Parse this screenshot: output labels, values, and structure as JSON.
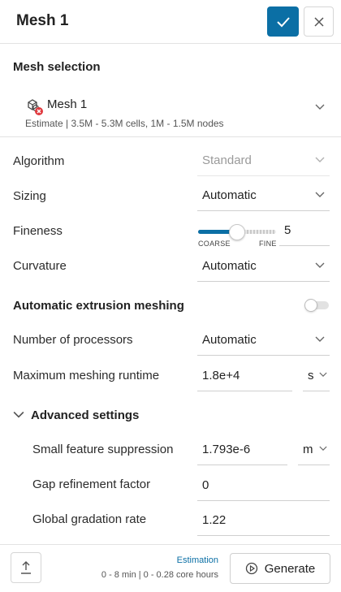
{
  "header": {
    "title": "Mesh 1",
    "confirm_icon": "check-icon",
    "close_icon": "close-icon"
  },
  "mesh_selection": {
    "title": "Mesh selection",
    "mesh_name": "Mesh 1",
    "estimate": "Estimate | 3.5M - 5.3M cells, 1M - 1.5M nodes",
    "icon": "mesh-error-icon"
  },
  "settings": {
    "algorithm": {
      "label": "Algorithm",
      "value": "Standard",
      "disabled": true
    },
    "sizing": {
      "label": "Sizing",
      "value": "Automatic"
    },
    "fineness": {
      "label": "Fineness",
      "value": "5",
      "level_fraction": 0.5,
      "min_label": "COARSE",
      "max_label": "FINE"
    },
    "curvature": {
      "label": "Curvature",
      "value": "Automatic"
    },
    "extrusion": {
      "label": "Automatic extrusion meshing",
      "enabled": false
    },
    "processors": {
      "label": "Number of processors",
      "value": "Automatic"
    },
    "runtime": {
      "label": "Maximum meshing runtime",
      "value": "1.8e+4",
      "unit": "s"
    }
  },
  "advanced": {
    "title": "Advanced settings",
    "expanded": true,
    "small_feature": {
      "label": "Small feature suppression",
      "value": "1.793e-6",
      "unit": "m"
    },
    "gap_refinement": {
      "label": "Gap refinement factor",
      "value": "0"
    },
    "gradation": {
      "label": "Global gradation rate",
      "value": "1.22"
    }
  },
  "footer": {
    "estimation_link": "Estimation",
    "estimation_time": "0 - 8 min | 0 - 0.28 core hours",
    "generate_label": "Generate",
    "upload_icon": "upload-icon",
    "play_icon": "play-circle-icon"
  },
  "colors": {
    "accent": "#0b6fa5",
    "error": "#e0393e"
  }
}
